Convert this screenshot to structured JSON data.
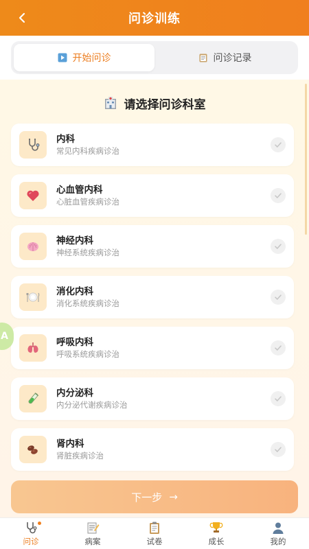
{
  "header": {
    "title": "问诊训练"
  },
  "tabs": [
    {
      "label": "开始问诊",
      "icon": "play-icon",
      "active": true
    },
    {
      "label": "问诊记录",
      "icon": "clipboard-icon",
      "active": false
    }
  ],
  "section": {
    "title": "请选择问诊科室",
    "icon": "hospital-icon"
  },
  "departments": [
    {
      "name": "内科",
      "desc": "常见内科疾病诊治",
      "icon": "stethoscope-icon",
      "selected": false
    },
    {
      "name": "心血管内科",
      "desc": "心脏血管疾病诊治",
      "icon": "heart-icon",
      "selected": false
    },
    {
      "name": "神经内科",
      "desc": "神经系统疾病诊治",
      "icon": "brain-icon",
      "selected": false
    },
    {
      "name": "消化内科",
      "desc": "消化系统疾病诊治",
      "icon": "plate-icon",
      "selected": false
    },
    {
      "name": "呼吸内科",
      "desc": "呼吸系统疾病诊治",
      "icon": "lungs-icon",
      "selected": false
    },
    {
      "name": "内分泌科",
      "desc": "内分泌代谢疾病诊治",
      "icon": "test-tube-icon",
      "selected": false
    },
    {
      "name": "肾内科",
      "desc": "肾脏疾病诊治",
      "icon": "kidney-icon",
      "selected": false
    }
  ],
  "next_button": {
    "label": "下一步",
    "arrow": "→"
  },
  "translate_bubble": {
    "label": "A"
  },
  "bottom_nav": [
    {
      "label": "问诊",
      "icon": "stethoscope-icon",
      "active": true
    },
    {
      "label": "病案",
      "icon": "memo-icon",
      "active": false
    },
    {
      "label": "试卷",
      "icon": "clipboard-icon",
      "active": false
    },
    {
      "label": "成长",
      "icon": "trophy-icon",
      "active": false
    },
    {
      "label": "我的",
      "icon": "user-icon",
      "active": false
    }
  ],
  "colors": {
    "accent": "#ec7d1f",
    "header": "#f07f1e",
    "card_icon_bg": "#fde9c8"
  }
}
